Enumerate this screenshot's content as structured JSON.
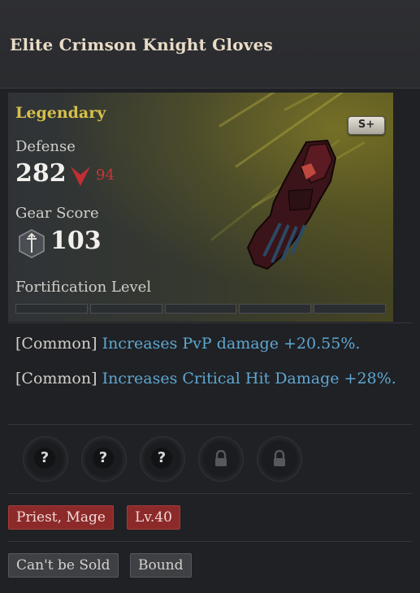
{
  "item": {
    "name": "Elite Crimson Knight Gloves",
    "grade": "Legendary",
    "rank_badge": "S+"
  },
  "stats": {
    "defense_label": "Defense",
    "defense_value": "282",
    "defense_diff": "94",
    "gear_score_label": "Gear Score",
    "gear_score_value": "103"
  },
  "fortification": {
    "label": "Fortification Level",
    "segments": 5,
    "filled": 0
  },
  "options": [
    {
      "tag": "[Common]",
      "text": "Increases PvP damage +20.55%."
    },
    {
      "tag": "[Common]",
      "text": "Increases Critical Hit Damage +28%."
    }
  ],
  "sockets": [
    {
      "state": "unknown",
      "glyph": "?"
    },
    {
      "state": "unknown",
      "glyph": "?"
    },
    {
      "state": "unknown",
      "glyph": "?"
    },
    {
      "state": "locked",
      "icon": "lock-icon"
    },
    {
      "state": "locked",
      "icon": "lock-icon"
    }
  ],
  "requirements": {
    "classes": "Priest, Mage",
    "level": "Lv.40"
  },
  "flags": {
    "sell": "Can't be Sold",
    "bind": "Bound"
  },
  "colors": {
    "legendary": "#d7c04a",
    "option_text": "#5fa7d0",
    "negative": "#c6363a",
    "requirement_tag": "#8c2a2a"
  }
}
